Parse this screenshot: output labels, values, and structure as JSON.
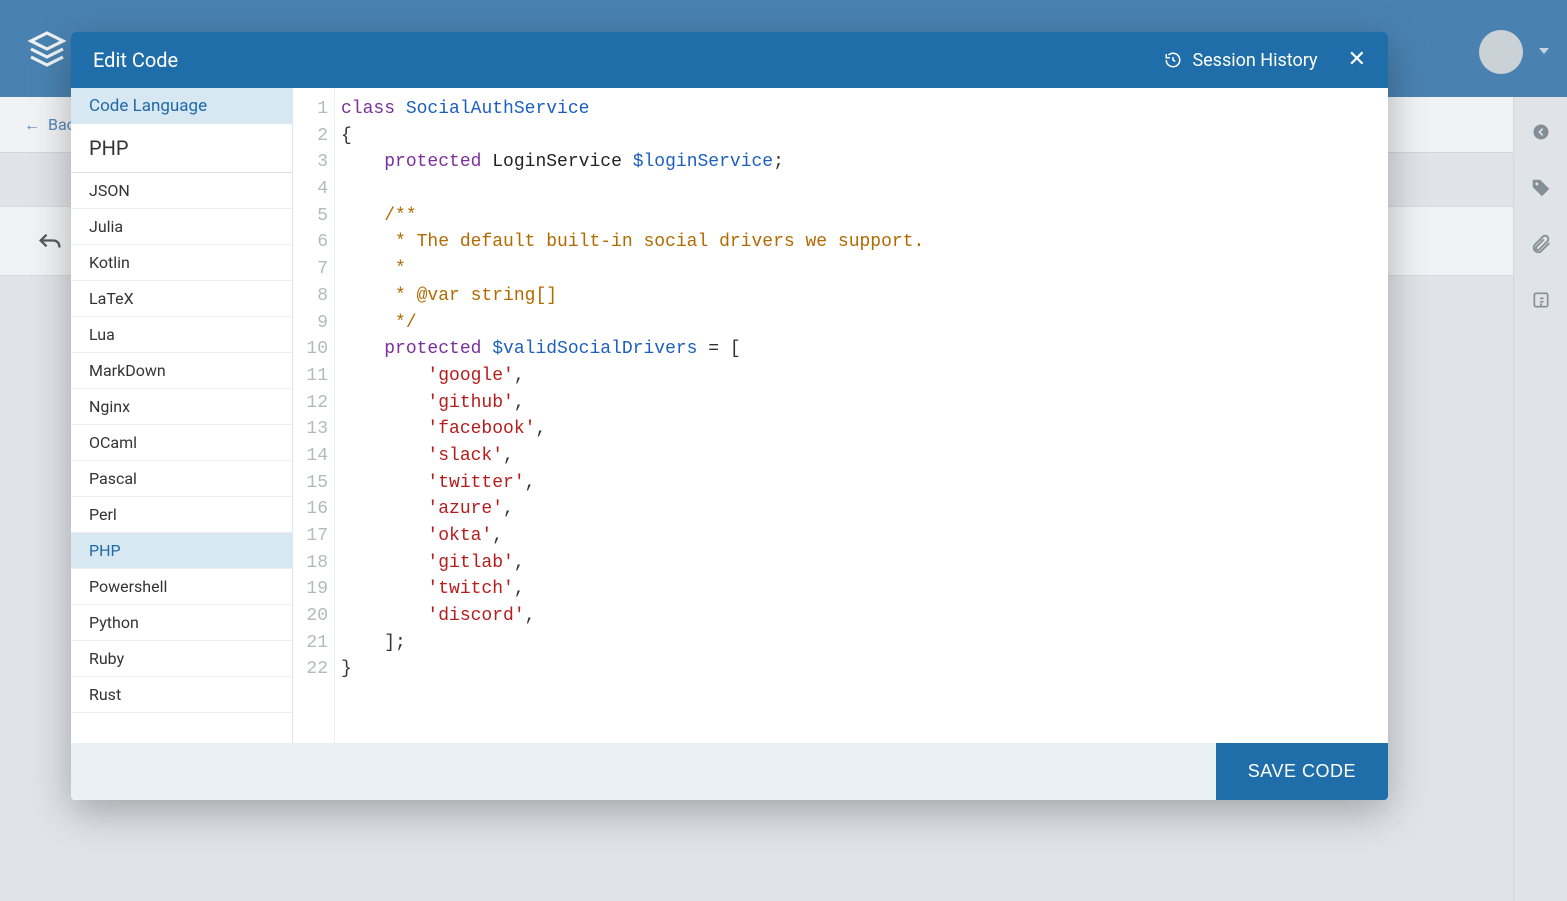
{
  "background": {
    "back_link": "Bac",
    "rail_icons": [
      "caret-left-circle-icon",
      "tag-icon",
      "attachment-icon",
      "outline-icon"
    ]
  },
  "modal": {
    "title": "Edit Code",
    "session_history": "Session History",
    "save_button": "SAVE CODE",
    "sidebar": {
      "header": "Code Language",
      "current": "PHP",
      "languages": [
        {
          "label": "JSON",
          "selected": false
        },
        {
          "label": "Julia",
          "selected": false
        },
        {
          "label": "Kotlin",
          "selected": false
        },
        {
          "label": "LaTeX",
          "selected": false
        },
        {
          "label": "Lua",
          "selected": false
        },
        {
          "label": "MarkDown",
          "selected": false
        },
        {
          "label": "Nginx",
          "selected": false
        },
        {
          "label": "OCaml",
          "selected": false
        },
        {
          "label": "Pascal",
          "selected": false
        },
        {
          "label": "Perl",
          "selected": false
        },
        {
          "label": "PHP",
          "selected": true
        },
        {
          "label": "Powershell",
          "selected": false
        },
        {
          "label": "Python",
          "selected": false
        },
        {
          "label": "Ruby",
          "selected": false
        },
        {
          "label": "Rust",
          "selected": false
        }
      ]
    },
    "code": {
      "lines": [
        [
          {
            "t": "kw",
            "v": "class"
          },
          {
            "t": "sp",
            "v": " "
          },
          {
            "t": "type",
            "v": "SocialAuthService"
          }
        ],
        [
          {
            "t": "punc",
            "v": "{"
          }
        ],
        [
          {
            "t": "sp",
            "v": "    "
          },
          {
            "t": "kw",
            "v": "protected"
          },
          {
            "t": "sp",
            "v": " "
          },
          {
            "t": "plain",
            "v": "LoginService "
          },
          {
            "t": "var",
            "v": "$loginService"
          },
          {
            "t": "punc",
            "v": ";"
          }
        ],
        [],
        [
          {
            "t": "sp",
            "v": "    "
          },
          {
            "t": "cm",
            "v": "/**"
          }
        ],
        [
          {
            "t": "sp",
            "v": "    "
          },
          {
            "t": "cm",
            "v": " * The default built-in social drivers we support."
          }
        ],
        [
          {
            "t": "sp",
            "v": "    "
          },
          {
            "t": "cm",
            "v": " *"
          }
        ],
        [
          {
            "t": "sp",
            "v": "    "
          },
          {
            "t": "cm",
            "v": " * @var string[]"
          }
        ],
        [
          {
            "t": "sp",
            "v": "    "
          },
          {
            "t": "cm",
            "v": " */"
          }
        ],
        [
          {
            "t": "sp",
            "v": "    "
          },
          {
            "t": "kw",
            "v": "protected"
          },
          {
            "t": "sp",
            "v": " "
          },
          {
            "t": "var",
            "v": "$validSocialDrivers"
          },
          {
            "t": "sp",
            "v": " "
          },
          {
            "t": "punc",
            "v": "= ["
          }
        ],
        [
          {
            "t": "sp",
            "v": "        "
          },
          {
            "t": "str",
            "v": "'google'"
          },
          {
            "t": "punc",
            "v": ","
          }
        ],
        [
          {
            "t": "sp",
            "v": "        "
          },
          {
            "t": "str",
            "v": "'github'"
          },
          {
            "t": "punc",
            "v": ","
          }
        ],
        [
          {
            "t": "sp",
            "v": "        "
          },
          {
            "t": "str",
            "v": "'facebook'"
          },
          {
            "t": "punc",
            "v": ","
          }
        ],
        [
          {
            "t": "sp",
            "v": "        "
          },
          {
            "t": "str",
            "v": "'slack'"
          },
          {
            "t": "punc",
            "v": ","
          }
        ],
        [
          {
            "t": "sp",
            "v": "        "
          },
          {
            "t": "str",
            "v": "'twitter'"
          },
          {
            "t": "punc",
            "v": ","
          }
        ],
        [
          {
            "t": "sp",
            "v": "        "
          },
          {
            "t": "str",
            "v": "'azure'"
          },
          {
            "t": "punc",
            "v": ","
          }
        ],
        [
          {
            "t": "sp",
            "v": "        "
          },
          {
            "t": "str",
            "v": "'okta'"
          },
          {
            "t": "punc",
            "v": ","
          }
        ],
        [
          {
            "t": "sp",
            "v": "        "
          },
          {
            "t": "str",
            "v": "'gitlab'"
          },
          {
            "t": "punc",
            "v": ","
          }
        ],
        [
          {
            "t": "sp",
            "v": "        "
          },
          {
            "t": "str",
            "v": "'twitch'"
          },
          {
            "t": "punc",
            "v": ","
          }
        ],
        [
          {
            "t": "sp",
            "v": "        "
          },
          {
            "t": "str",
            "v": "'discord'"
          },
          {
            "t": "punc",
            "v": ","
          }
        ],
        [
          {
            "t": "sp",
            "v": "    "
          },
          {
            "t": "punc",
            "v": "];"
          }
        ],
        [
          {
            "t": "punc",
            "v": "}"
          }
        ]
      ]
    }
  }
}
